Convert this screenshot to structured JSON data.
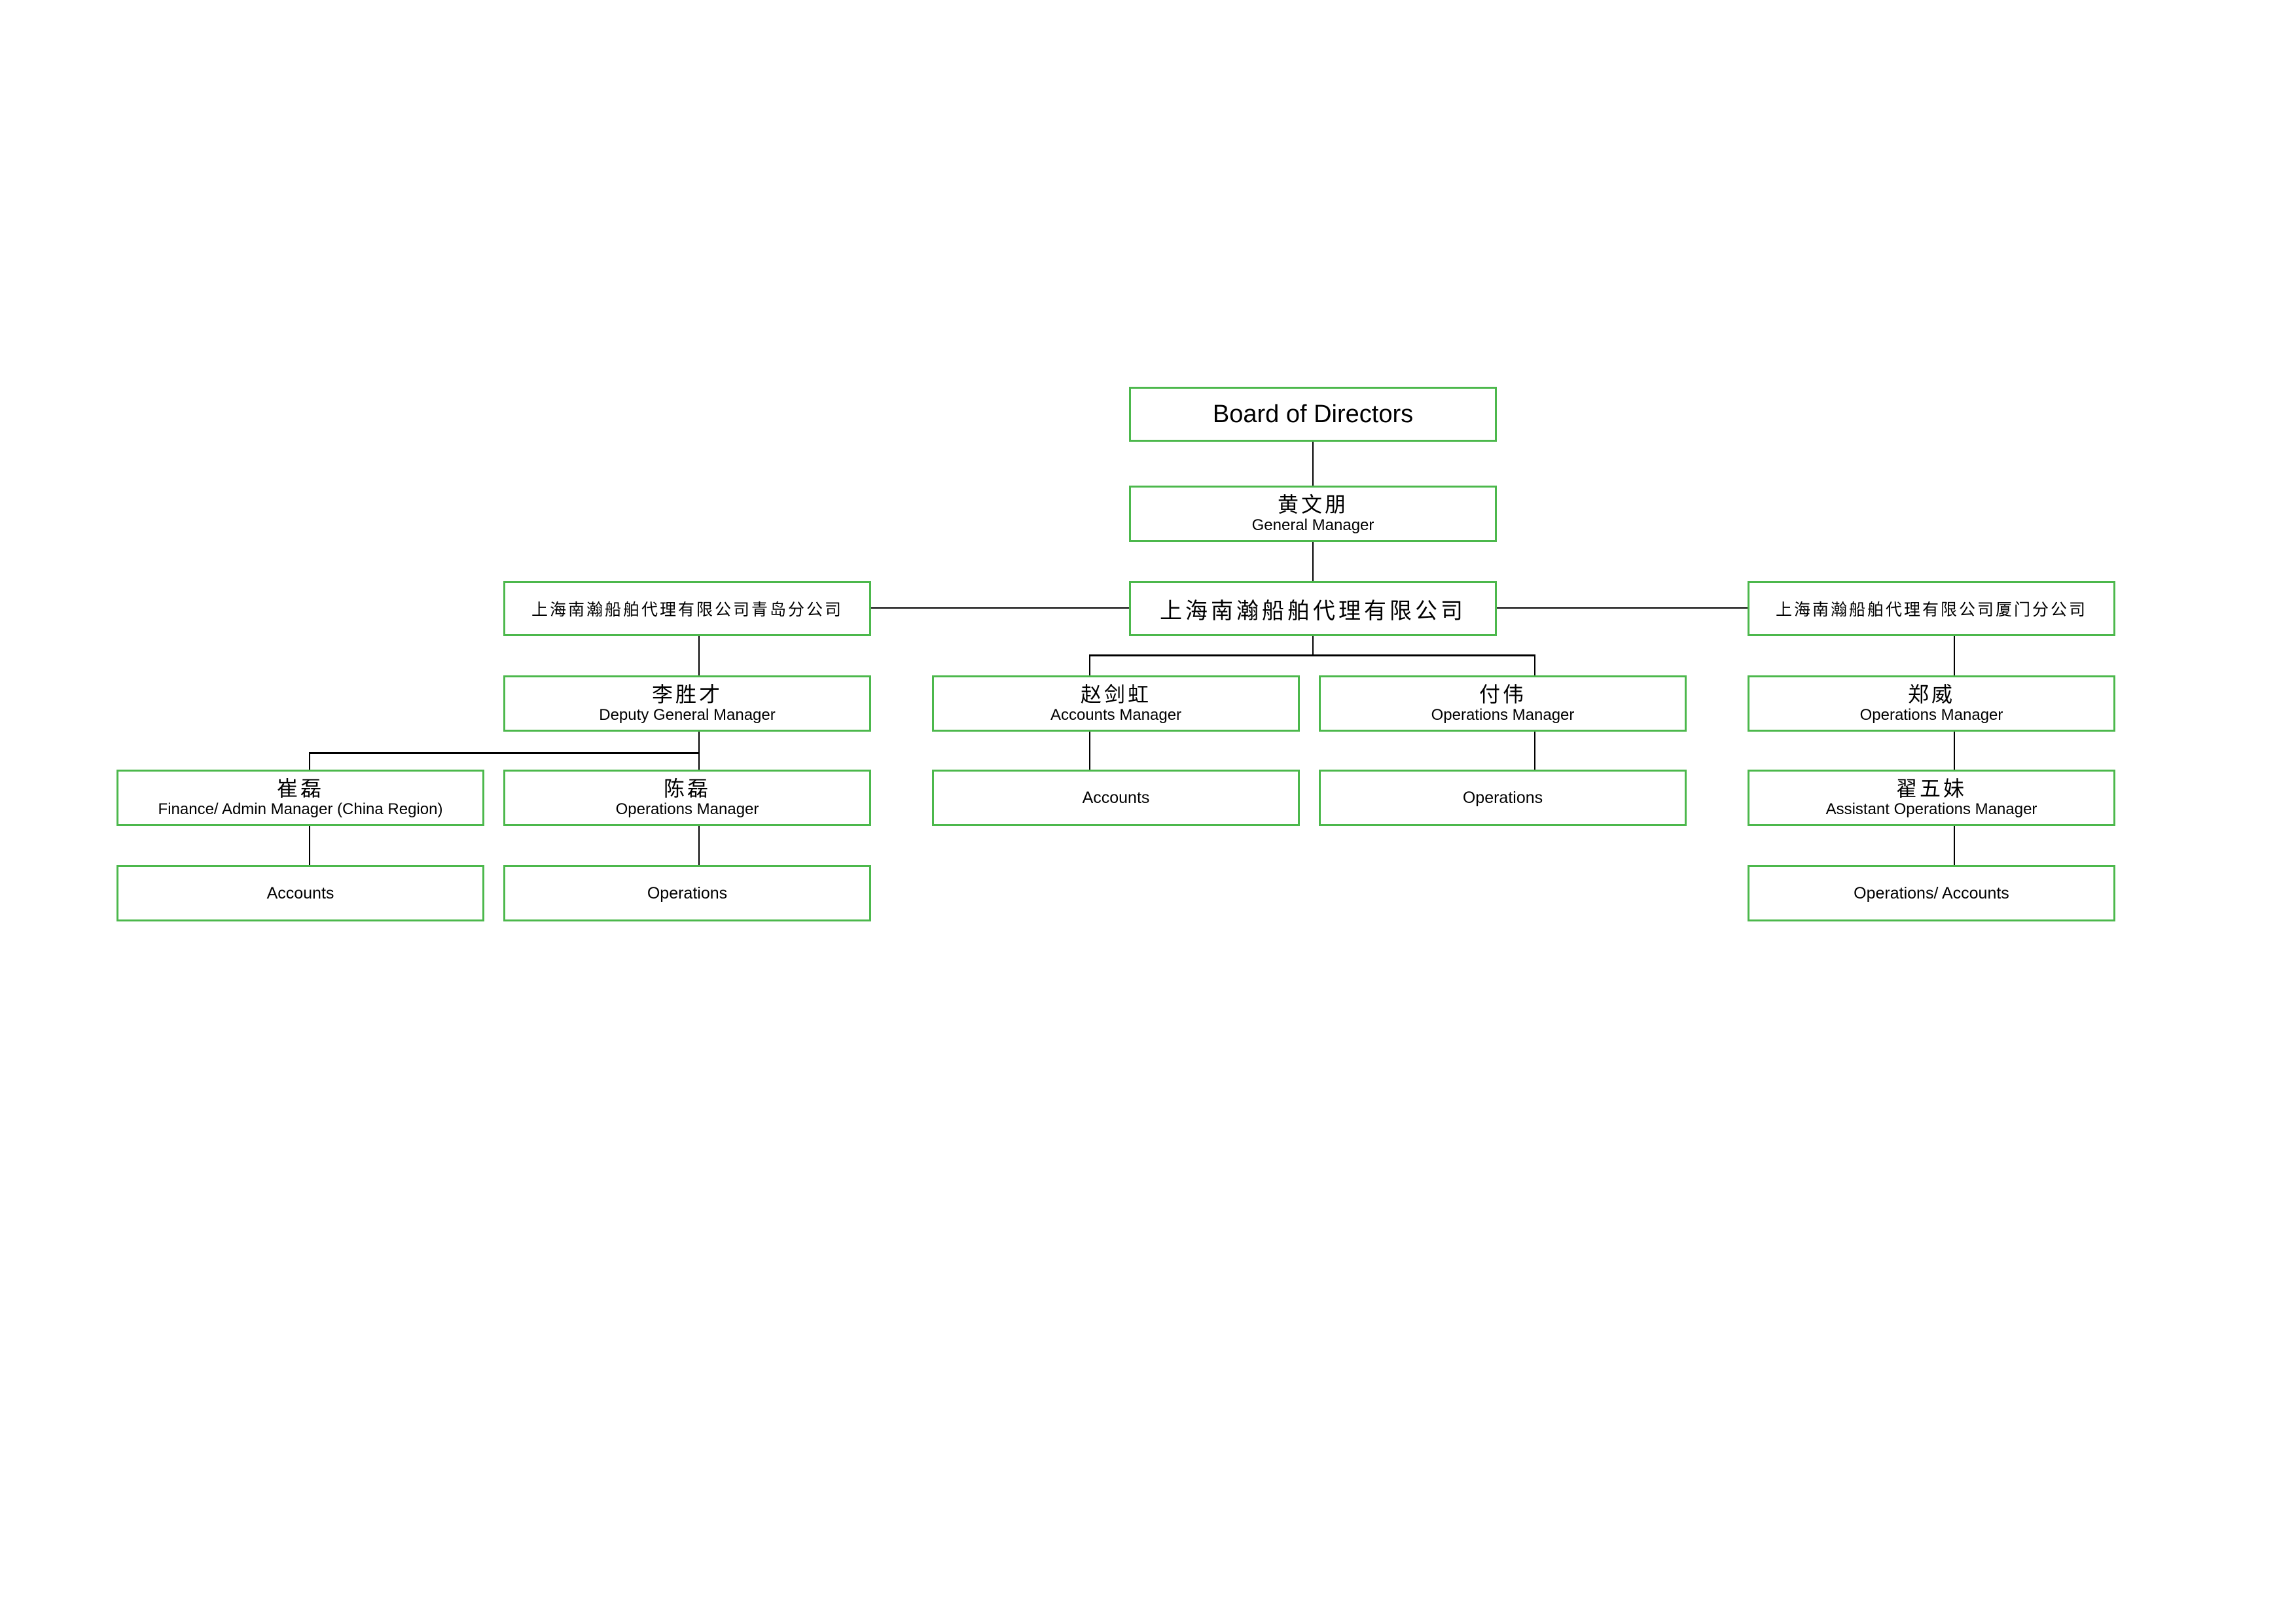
{
  "diagram": {
    "type": "org-chart",
    "board": {
      "label": "Board of Directors"
    },
    "general_manager": {
      "name": "黄文朋",
      "title": "General Manager"
    },
    "company": {
      "label": "上海南瀚船舶代理有限公司"
    },
    "qingdao_branch": {
      "label": "上海南瀚船舶代理有限公司青岛分公司",
      "deputy_gm": {
        "name": "李胜才",
        "title": "Deputy General Manager"
      },
      "finance_manager": {
        "name": "崔磊",
        "title": "Finance/ Admin Manager (China Region)",
        "dept": "Accounts"
      },
      "operations_manager": {
        "name": "陈磊",
        "title": "Operations Manager",
        "dept": "Operations"
      }
    },
    "head_office": {
      "accounts_manager": {
        "name": "赵剑虹",
        "title": "Accounts Manager",
        "dept": "Accounts"
      },
      "operations_manager": {
        "name": "付伟",
        "title": "Operations Manager",
        "dept": "Operations"
      }
    },
    "xiamen_branch": {
      "label": "上海南瀚船舶代理有限公司厦门分公司",
      "operations_manager": {
        "name": "郑威",
        "title": "Operations Manager"
      },
      "assistant_ops_manager": {
        "name": "翟五妹",
        "title": "Assistant Operations Manager",
        "dept": "Operations/ Accounts"
      }
    },
    "colors": {
      "box_border": "#4cb84c",
      "connector": "#000000",
      "background": "#ffffff"
    }
  }
}
